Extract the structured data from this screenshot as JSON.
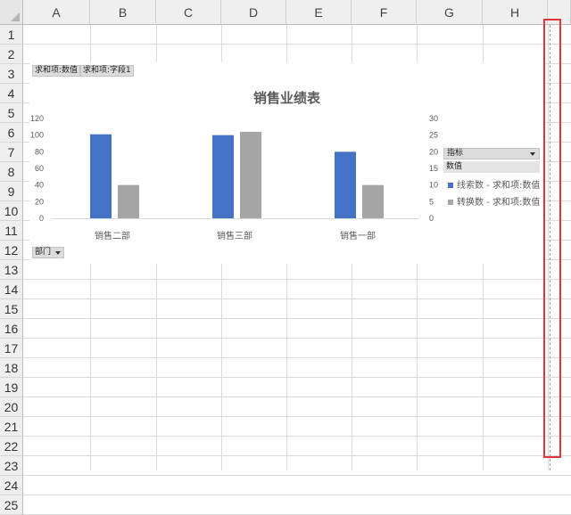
{
  "columns": [
    "A",
    "B",
    "C",
    "D",
    "E",
    "F",
    "G",
    "H"
  ],
  "rows": [
    "1",
    "2",
    "3",
    "4",
    "5",
    "6",
    "7",
    "8",
    "9",
    "10",
    "11",
    "12",
    "13",
    "14",
    "15",
    "16",
    "17",
    "18",
    "19",
    "20",
    "21",
    "22",
    "23",
    "24",
    "25"
  ],
  "chart": {
    "pivot_buttons": [
      "求和项:数值",
      "求和项:字段1"
    ],
    "legend_header": "指标",
    "legend_subheader": "数值",
    "filter_button": "部门"
  },
  "chart_data": {
    "type": "bar",
    "title": "销售业绩表",
    "categories": [
      "销售二部",
      "销售三部",
      "销售一部"
    ],
    "series": [
      {
        "name": "线索数 - 求和项:数值",
        "axis": "left",
        "color": "#4472c4",
        "values": [
          101,
          100,
          80
        ]
      },
      {
        "name": "转换数 - 求和项:数值",
        "axis": "right",
        "color": "#a5a5a5",
        "values": [
          10,
          26,
          10
        ]
      }
    ],
    "y_left": {
      "ticks": [
        0,
        20,
        40,
        60,
        80,
        100,
        120
      ],
      "ylim": [
        0,
        120
      ]
    },
    "y_right": {
      "ticks": [
        0,
        5,
        10,
        15,
        20,
        25,
        30
      ],
      "ylim": [
        0,
        30
      ]
    },
    "legend_position": "right",
    "grid": false
  }
}
